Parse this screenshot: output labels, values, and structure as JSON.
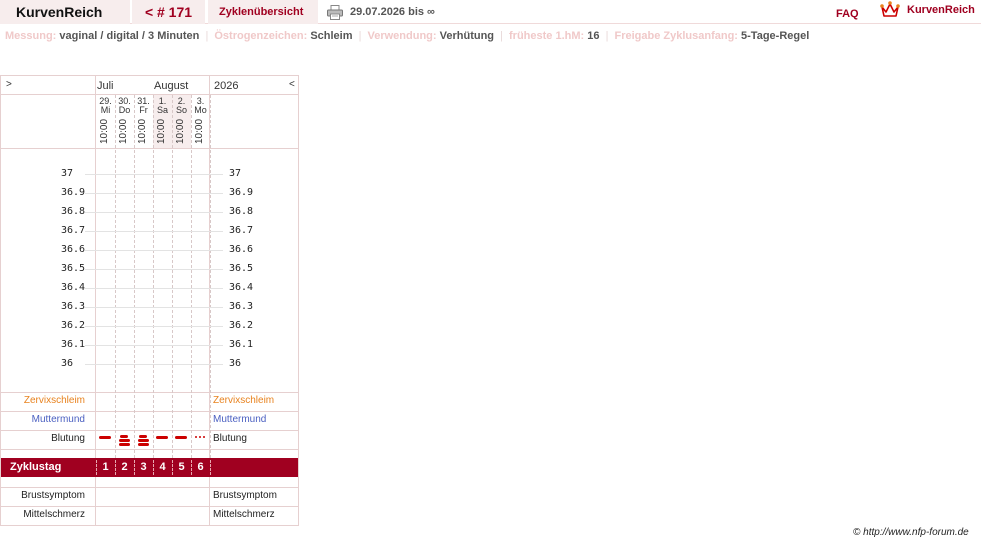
{
  "header": {
    "brand": "KurvenReich",
    "cycle": "< # 171",
    "overview": "Zyklenübersicht",
    "date_range": "29.07.2026 bis ∞",
    "faq": "FAQ",
    "logo_text": "KurvenReich",
    "accent_color": "#a00020"
  },
  "info": {
    "messung_label": "Messung:",
    "messung_value": "vaginal / digital / 3 Minuten",
    "oestrogen_label": "Östrogenzeichen:",
    "oestrogen_value": "Schleim",
    "verwendung_label": "Verwendung:",
    "verwendung_value": "Verhütung",
    "hm_label": "früheste 1.hM:",
    "hm_value": "16",
    "freigabe_label": "Freigabe Zyklusanfang:",
    "freigabe_value": "5-Tage-Regel"
  },
  "chart": {
    "nav_prev": ">",
    "nav_next": "<",
    "month_1": "Juli",
    "month_2": "August",
    "year": "2026",
    "days": [
      {
        "num": "29.",
        "name": "Mi",
        "time": "10:00",
        "weekend": false
      },
      {
        "num": "30.",
        "name": "Do",
        "time": "10:00",
        "weekend": false
      },
      {
        "num": "31.",
        "name": "Fr",
        "time": "10:00",
        "weekend": false
      },
      {
        "num": "1.",
        "name": "Sa",
        "time": "10:00",
        "weekend": true
      },
      {
        "num": "2.",
        "name": "So",
        "time": "10:00",
        "weekend": true
      },
      {
        "num": "3.",
        "name": "Mo",
        "time": "10:00",
        "weekend": false
      }
    ],
    "temps": [
      "37",
      "36.9",
      "36.8",
      "36.7",
      "36.6",
      "36.5",
      "36.4",
      "36.3",
      "36.2",
      "36.1",
      "36"
    ],
    "rows": {
      "zervix": "Zervixschleim",
      "mutter": "Muttermund",
      "blutung": "Blutung",
      "zyklustag": "Zyklustag",
      "brust": "Brustsymptom",
      "mittel": "Mittelschmerz"
    },
    "bleeding": [
      "medium",
      "heavy",
      "heavy",
      "medium",
      "medium",
      "spotting"
    ],
    "cycle_days": [
      "1",
      "2",
      "3",
      "4",
      "5",
      "6"
    ]
  },
  "footer": {
    "copyright": "© http://www.nfp-forum.de"
  }
}
